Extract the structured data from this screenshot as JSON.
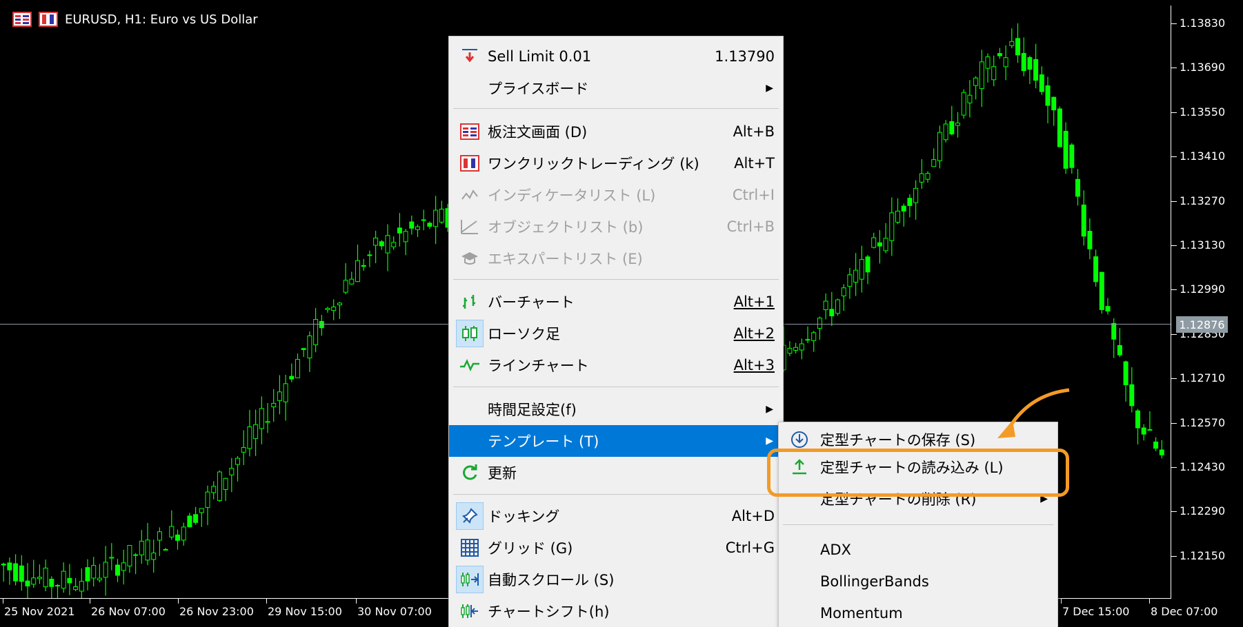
{
  "window": {
    "title": "EURUSD, H1:  Euro vs US Dollar",
    "icons": [
      "order-book-icon",
      "one-click-trading-icon"
    ]
  },
  "price_axis": {
    "labels": [
      "1.13830",
      "1.13690",
      "1.13550",
      "1.13410",
      "1.13270",
      "1.13130",
      "1.12990",
      "1.12850",
      "1.12710",
      "1.12570",
      "1.12430",
      "1.12290",
      "1.12150"
    ],
    "current_price": "1.12876"
  },
  "time_axis": {
    "labels": [
      "25 Nov 2021",
      "26 Nov 07:00",
      "26 Nov 23:00",
      "29 Nov 15:00",
      "30 Nov 07:00",
      "7 Dec 15:00",
      "8 Dec 07:00"
    ]
  },
  "chart_data": {
    "type": "candlestick",
    "title": "EURUSD, H1:  Euro vs US Dollar",
    "ylim": [
      1.1206,
      1.1395
    ],
    "current_price": 1.12876,
    "colors": {
      "candle": "#00ff00",
      "background": "#000000",
      "price_line": "#8e9ba3"
    },
    "close_path": [
      1.1218,
      1.1214,
      1.1211,
      1.1212,
      1.1216,
      1.1221,
      1.1226,
      1.1235,
      1.1248,
      1.1262,
      1.1278,
      1.1294,
      1.1309,
      1.1318,
      1.1322,
      1.1326,
      1.1318,
      1.1304,
      1.1296,
      1.1292,
      1.1288,
      1.1282,
      1.1275,
      1.127,
      1.1268,
      1.1272,
      1.128,
      1.1289,
      1.1298,
      1.131,
      1.1325,
      1.134,
      1.1356,
      1.1372,
      1.138,
      1.1368,
      1.134,
      1.13,
      1.1265,
      1.125
    ]
  },
  "context_menu": {
    "items": [
      {
        "name": "sell-limit",
        "label": "Sell Limit 0.01",
        "shortcut": "1.13790",
        "icon": "sell-limit-icon"
      },
      {
        "name": "price-board",
        "label": "プライスボード",
        "submenu": true
      },
      {
        "name": "order-book",
        "label": "板注文画面 (D)",
        "shortcut": "Alt+B",
        "icon": "order-book-icon"
      },
      {
        "name": "one-click-trading",
        "label": "ワンクリックトレーディング (k)",
        "shortcut": "Alt+T",
        "icon": "one-click-trading-icon"
      },
      {
        "name": "indicator-list",
        "label": "インディケータリスト (L)",
        "shortcut": "Ctrl+I",
        "icon": "indicator-icon",
        "disabled": true
      },
      {
        "name": "object-list",
        "label": "オブジェクトリスト (b)",
        "shortcut": "Ctrl+B",
        "icon": "object-icon",
        "disabled": true
      },
      {
        "name": "expert-list",
        "label": "エキスパートリスト (E)",
        "icon": "expert-icon",
        "disabled": true
      },
      {
        "name": "bar-chart",
        "label": "バーチャート",
        "shortcut": "Alt+1",
        "icon": "bar-chart-icon"
      },
      {
        "name": "candlestick",
        "label": "ローソク足",
        "shortcut": "Alt+2",
        "icon": "candlestick-icon"
      },
      {
        "name": "line-chart",
        "label": "ラインチャート",
        "shortcut": "Alt+3",
        "icon": "line-chart-icon"
      },
      {
        "name": "timeframe",
        "label": "時間足設定(f)",
        "submenu": true
      },
      {
        "name": "template",
        "label": "テンプレート (T)",
        "submenu": true,
        "selected": true
      },
      {
        "name": "refresh",
        "label": "更新",
        "icon": "refresh-icon"
      },
      {
        "name": "docking",
        "label": "ドッキング",
        "shortcut": "Alt+D",
        "icon": "pin-icon"
      },
      {
        "name": "grid",
        "label": "グリッド (G)",
        "shortcut": "Ctrl+G",
        "icon": "grid-icon"
      },
      {
        "name": "auto-scroll",
        "label": "自動スクロール (S)",
        "icon": "auto-scroll-icon"
      },
      {
        "name": "chart-shift",
        "label": "チャートシフト(h)",
        "icon": "chart-shift-icon"
      }
    ]
  },
  "template_submenu": {
    "items": [
      {
        "name": "save-template",
        "label": "定型チャートの保存 (S)",
        "icon": "save-template-icon"
      },
      {
        "name": "load-template",
        "label": "定型チャートの読み込み (L)",
        "icon": "upload-icon"
      },
      {
        "name": "delete-template",
        "label": "定型チャートの削除 (R)",
        "submenu": true
      },
      {
        "name": "template-adx",
        "label": "ADX"
      },
      {
        "name": "template-bollinger",
        "label": "BollingerBands"
      },
      {
        "name": "template-momentum",
        "label": "Momentum"
      }
    ]
  },
  "annotation": {
    "highlight_color": "#f39b26"
  }
}
